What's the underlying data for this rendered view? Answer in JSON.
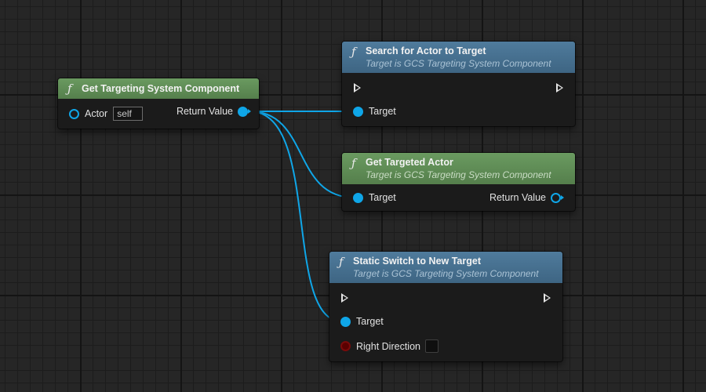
{
  "colors": {
    "pure_function_header": "#5f8c55",
    "function_header": "#46708f",
    "object_pin": "#0fa6e8",
    "bool_pin": "#7a0a0a",
    "wire": "#0fa6e8"
  },
  "nodes": {
    "get_component": {
      "icon": "function-icon",
      "title": "Get Targeting System Component",
      "actor_label": "Actor",
      "actor_default": "self",
      "return_label": "Return Value"
    },
    "search_target": {
      "icon": "function-icon",
      "title": "Search for Actor to Target",
      "subtitle": "Target is GCS Targeting System Component",
      "target_label": "Target"
    },
    "get_targeted_actor": {
      "icon": "function-icon",
      "title": "Get Targeted Actor",
      "subtitle": "Target is GCS Targeting System Component",
      "target_label": "Target",
      "return_label": "Return Value"
    },
    "static_switch": {
      "icon": "function-icon",
      "title": "Static Switch to New Target",
      "subtitle": "Target is GCS Targeting System Component",
      "target_label": "Target",
      "direction_label": "Right Direction",
      "direction_value": false
    }
  }
}
